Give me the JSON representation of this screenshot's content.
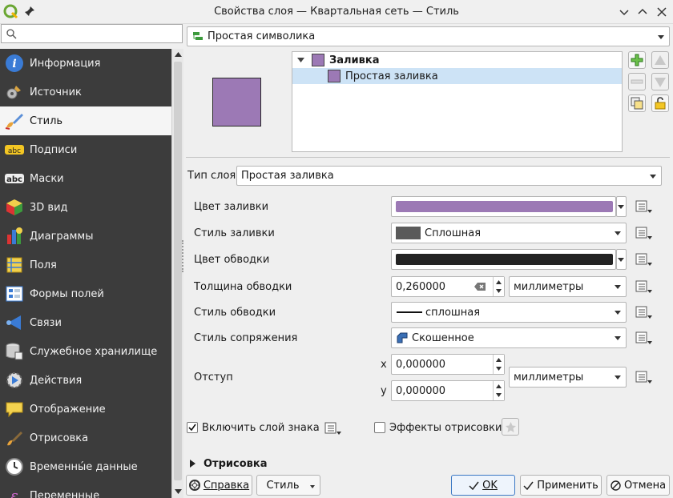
{
  "window": {
    "title": "Свойства слоя — Квартальная сеть — Стиль"
  },
  "search": {
    "placeholder": ""
  },
  "nav": [
    {
      "label": "Информация",
      "icon": "info-icon"
    },
    {
      "label": "Источник",
      "icon": "source-icon"
    },
    {
      "label": "Стиль",
      "icon": "paintbrush-icon",
      "selected": true
    },
    {
      "label": "Подписи",
      "icon": "labels-icon"
    },
    {
      "label": "Маски",
      "icon": "masks-icon"
    },
    {
      "label": "3D вид",
      "icon": "cube-icon"
    },
    {
      "label": "Диаграммы",
      "icon": "diagram-icon"
    },
    {
      "label": "Поля",
      "icon": "fields-icon"
    },
    {
      "label": "Формы полей",
      "icon": "forms-icon"
    },
    {
      "label": "Связи",
      "icon": "joins-icon"
    },
    {
      "label": "Служебное хранилище",
      "icon": "storage-icon"
    },
    {
      "label": "Действия",
      "icon": "actions-icon"
    },
    {
      "label": "Отображение",
      "icon": "display-icon"
    },
    {
      "label": "Отрисовка",
      "icon": "rendering-icon"
    },
    {
      "label": "Временны́е данные",
      "icon": "clock-icon"
    },
    {
      "label": "Переменные",
      "icon": "variables-icon"
    }
  ],
  "renderer": {
    "value": "Простая символика"
  },
  "tree": {
    "root": "Заливка",
    "child": "Простая заливка"
  },
  "layer_type": {
    "label": "Тип слоя",
    "value": "Простая заливка"
  },
  "props": {
    "fill_color": "Цвет заливки",
    "fill_style": "Стиль заливки",
    "fill_style_value": "Сплошная",
    "stroke_color": "Цвет обводки",
    "stroke_width": "Толщина обводки",
    "stroke_width_value": "0,260000",
    "stroke_width_unit": "миллиметры",
    "stroke_style": "Стиль обводки",
    "stroke_style_value": "сплошная",
    "join_style": "Стиль сопряжения",
    "join_style_value": "Скошенное",
    "offset": "Отступ",
    "offset_x_label": "x",
    "offset_x": "0,000000",
    "offset_y_label": "y",
    "offset_y": "0,000000",
    "offset_unit": "миллиметры"
  },
  "enable_layer": "Включить слой знака",
  "effects": "Эффекты отрисовки",
  "render_section": "Отрисовка",
  "buttons": {
    "help": "Справка",
    "style": "Стиль",
    "ok": "OK",
    "apply": "Применить",
    "cancel": "Отмена"
  },
  "colors": {
    "fill": "#9c79b5",
    "stroke": "#232323",
    "accent": "#3b78c4",
    "nav_bg": "#3c3c3c"
  }
}
